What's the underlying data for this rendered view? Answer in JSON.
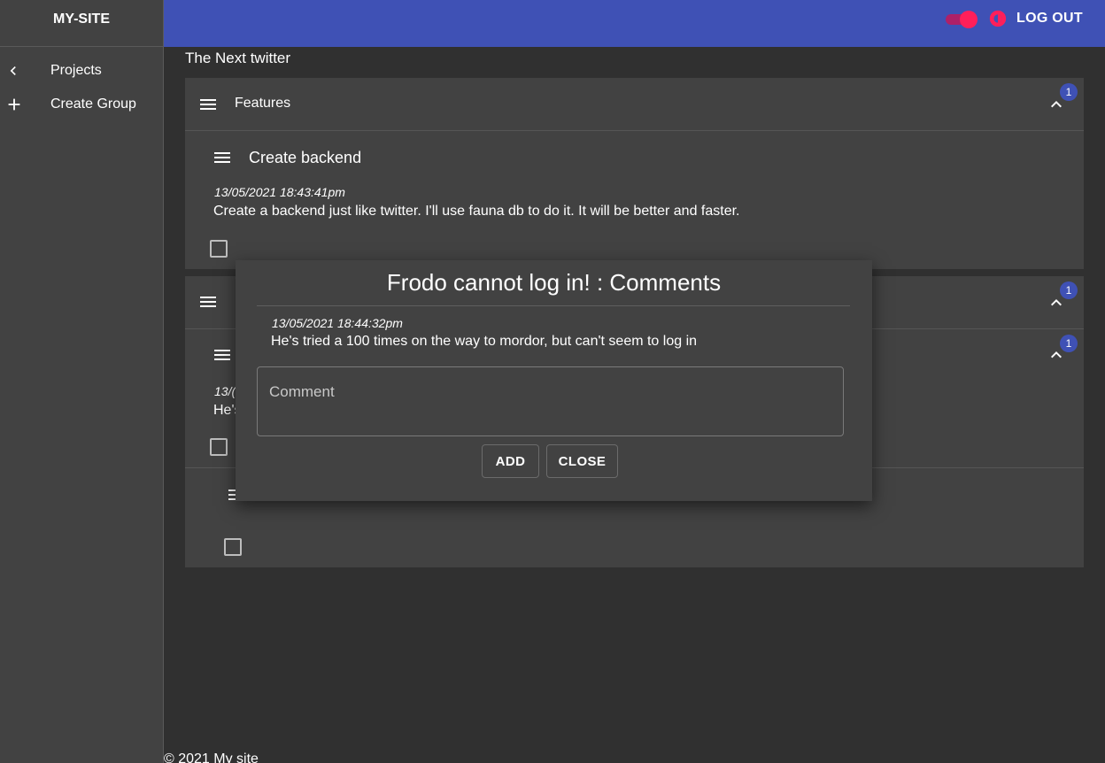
{
  "sidebar": {
    "brand": "MY-SITE",
    "items": [
      {
        "label": "Projects",
        "icon": "chevron-left-icon"
      },
      {
        "label": "Create Group",
        "icon": "plus-icon"
      }
    ]
  },
  "header": {
    "logout_label": "LOG OUT",
    "theme_toggle": "dark-mode-toggle"
  },
  "main": {
    "project_title": "The Next twitter",
    "groups": [
      {
        "title": "Features",
        "badge": "1",
        "tasks": [
          {
            "title": "Create backend",
            "date": "13/05/2021 18:43:41pm",
            "description": "Create a backend just like twitter. I'll use fauna db to do it. It will be better and faster."
          }
        ]
      },
      {
        "badge": "1",
        "tasks": [
          {
            "badge": "1",
            "date_fragment": "13/(",
            "desc_fragment": "He's"
          }
        ]
      }
    ]
  },
  "modal": {
    "title": "Frodo cannot log in! : Comments",
    "comment_date": "13/05/2021 18:44:32pm",
    "comment_text": "He's tried a 100 times on the way to mordor, but can't seem to log in",
    "input_placeholder": "Comment",
    "add_label": "ADD",
    "close_label": "CLOSE"
  },
  "footer": {
    "text": "© 2021 My site"
  },
  "colors": {
    "primary": "#3f51b5",
    "accent": "#ff1f5a",
    "surface": "#424242",
    "background": "#303030"
  }
}
